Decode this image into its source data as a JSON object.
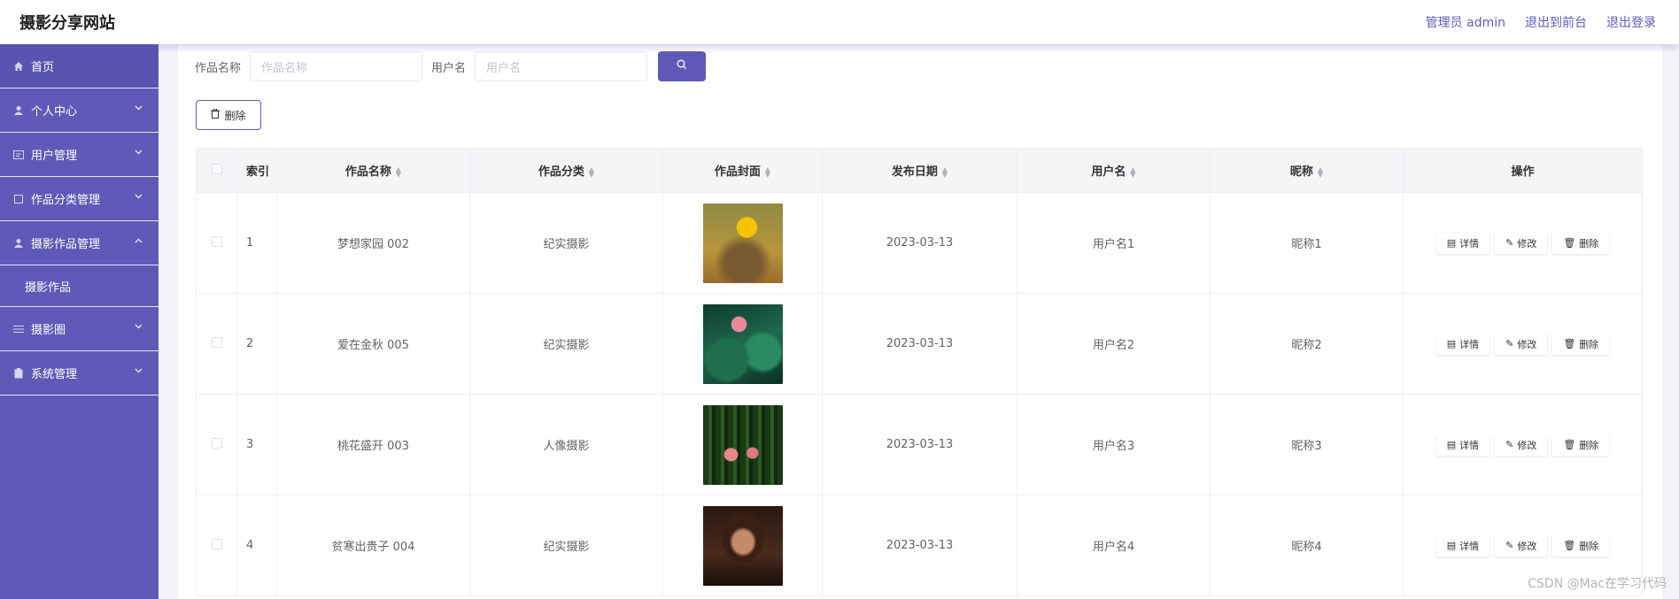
{
  "header": {
    "title": "摄影分享网站",
    "admin": "管理员 admin",
    "to_front": "退出到前台",
    "logout": "退出登录"
  },
  "sidebar": {
    "items": [
      {
        "label": "首页",
        "icon": "home-icon"
      },
      {
        "label": "个人中心",
        "icon": "user-icon"
      },
      {
        "label": "用户管理",
        "icon": "id-card-icon"
      },
      {
        "label": "作品分类管理",
        "icon": "square-icon"
      },
      {
        "label": "摄影作品管理",
        "icon": "person-icon"
      },
      {
        "label": "摄影作品",
        "icon": ""
      },
      {
        "label": "摄影圈",
        "icon": "list-icon"
      },
      {
        "label": "系统管理",
        "icon": "clipboard-icon"
      }
    ]
  },
  "search": {
    "work_name_label": "作品名称",
    "work_name_placeholder": "作品名称",
    "username_label": "用户名",
    "username_placeholder": "用户名"
  },
  "toolbar": {
    "delete_label": "删除"
  },
  "table": {
    "headers": [
      "索引",
      "作品名称",
      "作品分类",
      "作品封面",
      "发布日期",
      "用户名",
      "昵称",
      "操作"
    ],
    "rows": [
      {
        "index": "1",
        "name": "梦想家园 002",
        "category": "纪实摄影",
        "date": "2023-03-13",
        "user": "用户名1",
        "nick": "昵称1"
      },
      {
        "index": "2",
        "name": "爱在金秋 005",
        "category": "纪实摄影",
        "date": "2023-03-13",
        "user": "用户名2",
        "nick": "昵称2"
      },
      {
        "index": "3",
        "name": "桃花盛开 003",
        "category": "人像摄影",
        "date": "2023-03-13",
        "user": "用户名3",
        "nick": "昵称3"
      },
      {
        "index": "4",
        "name": "贫寒出贵子 004",
        "category": "纪实摄影",
        "date": "2023-03-13",
        "user": "用户名4",
        "nick": "昵称4"
      }
    ],
    "ops": {
      "detail": "详情",
      "edit": "修改",
      "delete": "删除"
    }
  },
  "watermark": "CSDN @Mac在学习代码",
  "colors": {
    "accent": "#5d5bb7"
  }
}
